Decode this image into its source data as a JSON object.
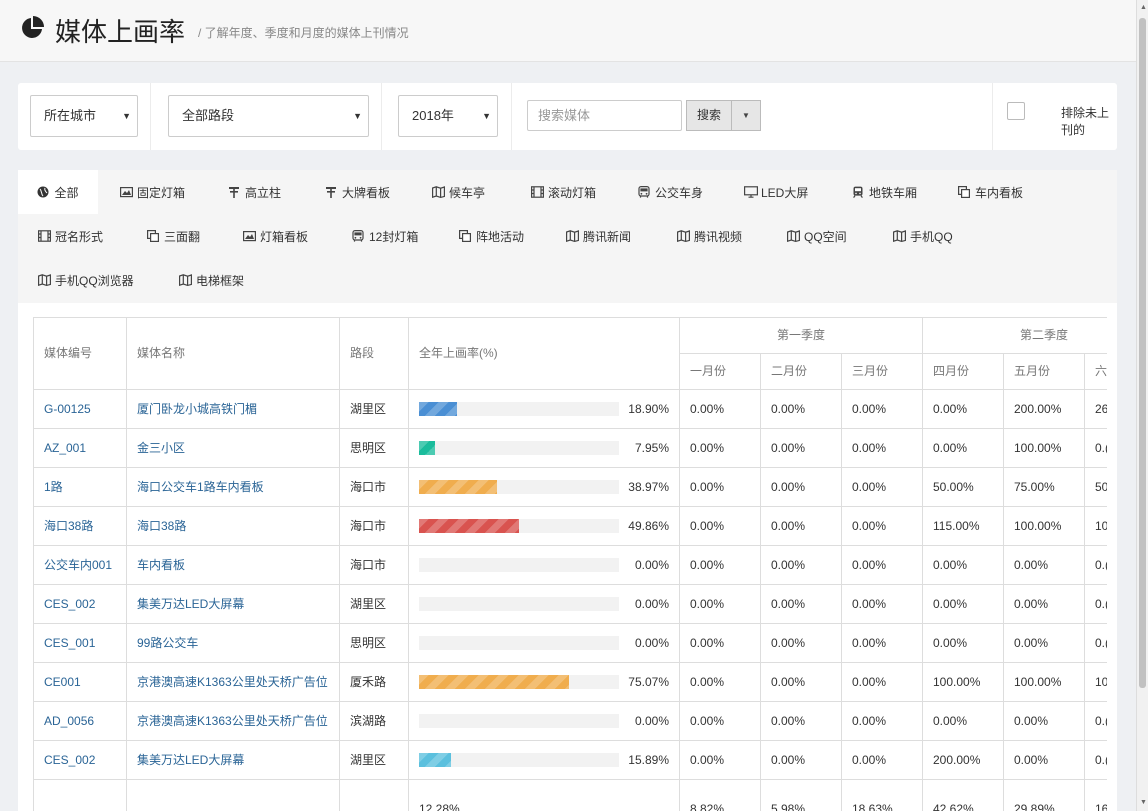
{
  "header": {
    "title": "媒体上画率",
    "subtitle": "/ 了解年度、季度和月度的媒体上刊情况"
  },
  "filters": {
    "city": "所在城市",
    "road": "全部路段",
    "year": "2018年",
    "search_placeholder": "搜索媒体",
    "search_button": "搜索",
    "exclude_label": "排除未上刊的"
  },
  "tabs": [
    {
      "label": "全部",
      "icon": "globe-icon"
    },
    {
      "label": "固定灯箱",
      "icon": "picture-icon"
    },
    {
      "label": "高立柱",
      "icon": "pillar-icon"
    },
    {
      "label": "大牌看板",
      "icon": "pillar-icon"
    },
    {
      "label": "候车亭",
      "icon": "map-icon"
    },
    {
      "label": "滚动灯箱",
      "icon": "film-icon"
    },
    {
      "label": "公交车身",
      "icon": "bus-icon"
    },
    {
      "label": "LED大屏",
      "icon": "monitor-icon"
    },
    {
      "label": "地铁车厢",
      "icon": "train-icon"
    },
    {
      "label": "车内看板",
      "icon": "copy-icon"
    },
    {
      "label": "冠名形式",
      "icon": "film-icon"
    },
    {
      "label": "三面翻",
      "icon": "copy-icon"
    },
    {
      "label": "灯箱看板",
      "icon": "picture-icon"
    },
    {
      "label": "12封灯箱",
      "icon": "bus-icon"
    },
    {
      "label": "阵地活动",
      "icon": "copy-icon"
    },
    {
      "label": "腾讯新闻",
      "icon": "map-icon"
    },
    {
      "label": "腾讯视频",
      "icon": "map-icon"
    },
    {
      "label": "QQ空间",
      "icon": "map-icon"
    },
    {
      "label": "手机QQ",
      "icon": "map-icon"
    },
    {
      "label": "手机QQ浏览器",
      "icon": "map-icon"
    },
    {
      "label": "电梯框架",
      "icon": "map-icon"
    }
  ],
  "table": {
    "headers": {
      "code": "媒体编号",
      "name": "媒体名称",
      "road": "路段",
      "annual": "全年上画率(%)",
      "q1": "第一季度",
      "q2": "第二季度",
      "months": [
        "一月份",
        "二月份",
        "三月份",
        "四月份",
        "五月份",
        "六"
      ]
    },
    "rows": [
      {
        "code": "G-00125",
        "name": "厦门卧龙小城高铁门楣",
        "road": "湖里区",
        "pct": "18.90%",
        "fill": 0.189,
        "color": "#4a8fd4",
        "m": [
          "0.00%",
          "0.00%",
          "0.00%",
          "0.00%",
          "200.00%",
          "26"
        ]
      },
      {
        "code": "AZ_001",
        "name": "金三小区",
        "road": "思明区",
        "pct": "7.95%",
        "fill": 0.0795,
        "color": "#1abc9c",
        "m": [
          "0.00%",
          "0.00%",
          "0.00%",
          "0.00%",
          "100.00%",
          "0.("
        ]
      },
      {
        "code": "1路",
        "name": "海口公交车1路车内看板",
        "road": "海口市",
        "pct": "38.97%",
        "fill": 0.3897,
        "color": "#f0ad4e",
        "m": [
          "0.00%",
          "0.00%",
          "0.00%",
          "50.00%",
          "75.00%",
          "50"
        ]
      },
      {
        "code": "海口38路",
        "name": "海口38路",
        "road": "海口市",
        "pct": "49.86%",
        "fill": 0.4986,
        "color": "#d9534f",
        "m": [
          "0.00%",
          "0.00%",
          "0.00%",
          "115.00%",
          "100.00%",
          "10"
        ]
      },
      {
        "code": "公交车内001",
        "name": "车内看板",
        "road": "海口市",
        "pct": "0.00%",
        "fill": 0,
        "color": "#4a8fd4",
        "m": [
          "0.00%",
          "0.00%",
          "0.00%",
          "0.00%",
          "0.00%",
          "0.("
        ]
      },
      {
        "code": "CES_002",
        "name": "集美万达LED大屏幕",
        "road": "湖里区",
        "pct": "0.00%",
        "fill": 0,
        "color": "#4a8fd4",
        "m": [
          "0.00%",
          "0.00%",
          "0.00%",
          "0.00%",
          "0.00%",
          "0.("
        ]
      },
      {
        "code": "CES_001",
        "name": "99路公交车",
        "road": "思明区",
        "pct": "0.00%",
        "fill": 0,
        "color": "#4a8fd4",
        "m": [
          "0.00%",
          "0.00%",
          "0.00%",
          "0.00%",
          "0.00%",
          "0.("
        ]
      },
      {
        "code": "CE001",
        "name": "京港澳高速K1363公里处天桥广告位",
        "road": "厦禾路",
        "pct": "75.07%",
        "fill": 0.7507,
        "color": "#f0ad4e",
        "m": [
          "0.00%",
          "0.00%",
          "0.00%",
          "100.00%",
          "100.00%",
          "10"
        ]
      },
      {
        "code": "AD_0056",
        "name": "京港澳高速K1363公里处天桥广告位",
        "road": "滨湖路",
        "pct": "0.00%",
        "fill": 0,
        "color": "#4a8fd4",
        "m": [
          "0.00%",
          "0.00%",
          "0.00%",
          "0.00%",
          "0.00%",
          "0.("
        ]
      },
      {
        "code": "CES_002",
        "name": "集美万达LED大屏幕",
        "road": "湖里区",
        "pct": "15.89%",
        "fill": 0.1589,
        "color": "#5bc0de",
        "m": [
          "0.00%",
          "0.00%",
          "0.00%",
          "200.00%",
          "0.00%",
          "0.("
        ]
      }
    ],
    "footer": {
      "annual": "12.28%",
      "m": [
        "8.82%",
        "5.98%",
        "18.63%",
        "42.62%",
        "29.89%",
        "16"
      ]
    }
  }
}
